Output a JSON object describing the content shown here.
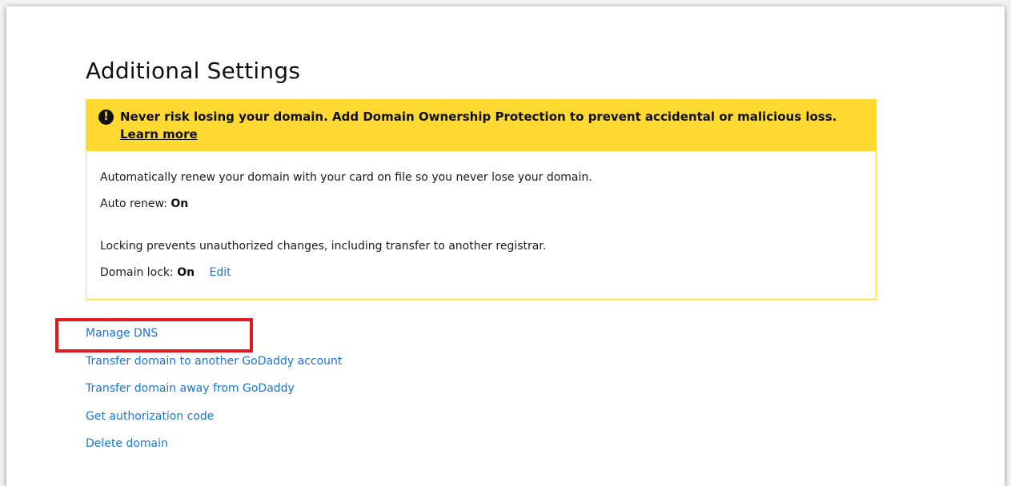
{
  "page": {
    "title": "Additional Settings"
  },
  "banner": {
    "icon": "info-icon",
    "icon_glyph": "!",
    "message": "Never risk losing your domain. Add Domain Ownership Protection to prevent accidental or malicious loss.",
    "link_label": "Learn more"
  },
  "auto_renew": {
    "description": "Automatically renew your domain with your card on file so you never lose your domain.",
    "label": "Auto renew:",
    "value": "On"
  },
  "domain_lock": {
    "description": "Locking prevents unauthorized changes, including transfer to another registrar.",
    "label": "Domain lock:",
    "value": "On",
    "edit_label": "Edit"
  },
  "actions": {
    "manage_dns": "Manage DNS",
    "transfer_account": "Transfer domain to another GoDaddy account",
    "transfer_away": "Transfer domain away from GoDaddy",
    "auth_code": "Get authorization code",
    "delete_domain": "Delete domain"
  },
  "colors": {
    "banner_yellow": "#fed932",
    "link_blue": "#1976d2",
    "highlight_red": "#e01a20"
  }
}
